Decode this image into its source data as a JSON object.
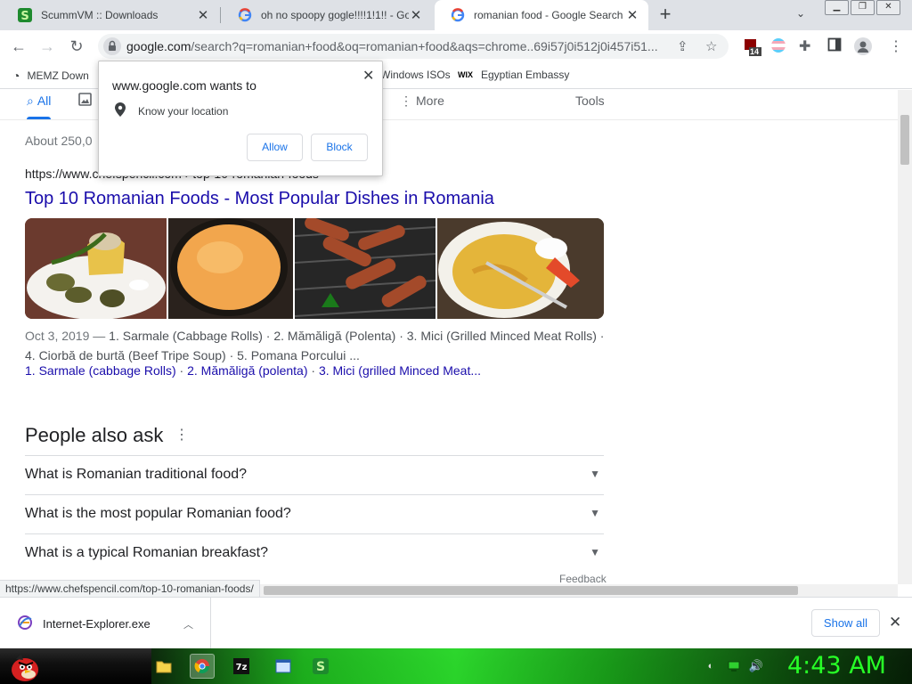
{
  "colors": {
    "link": "#1a0dab",
    "accent": "#1a73e8",
    "clock": "#27ff27"
  },
  "tabs": [
    {
      "title": "ScummVM :: Downloads",
      "icon": "scummvm-icon",
      "active": false
    },
    {
      "title": "oh no spoopy gogle!!!!1!1!! - Goo",
      "icon": "google-icon",
      "active": false
    },
    {
      "title": "romanian food - Google Search",
      "icon": "google-icon",
      "active": true
    }
  ],
  "omnibox": {
    "domain": "google.com",
    "path": "/search?q=romanian+food&oq=romanian+food&aqs=chrome..69i57j0i512j0i457i51..."
  },
  "extensions": {
    "badge": "14"
  },
  "bookmarks": [
    {
      "label": "MEMZ Down",
      "icon": "memz-icon"
    },
    {
      "label": "Windows ISOs",
      "icon": "windows-icon"
    },
    {
      "label": "Egyptian Embassy",
      "icon": "wix-icon"
    }
  ],
  "search_nav": {
    "all": "All",
    "more": "More",
    "tools": "Tools"
  },
  "result": {
    "stats": "About 250,0",
    "cite": "https://www.chefspencil.com › top-10-romanian-foods",
    "title": "Top 10 Romanian Foods - Most Popular Dishes in Romania",
    "date": "Oct 3, 2019 — ",
    "snippet": "1. Sarmale (Cabbage Rolls) · 2. Mămăligă (Polenta) · 3. Mici (Grilled Minced Meat Rolls) · 4. Ciorbă de burtă (Beef Tripe Soup) · 5. Pomana Porcului ...",
    "sublinks": [
      "1. Sarmale (cabbage Rolls)",
      "2. Mămăligă (polenta)",
      "3. Mici (grilled Minced Meat..."
    ]
  },
  "paa": {
    "title": "People also ask",
    "questions": [
      "What is Romanian traditional food?",
      "What is the most popular Romanian food?",
      "What is a typical Romanian breakfast?"
    ],
    "feedback": "Feedback"
  },
  "status_url": "https://www.chefspencil.com/top-10-romanian-foods/",
  "permission_popup": {
    "title": "www.google.com wants to",
    "request": "Know your location",
    "allow": "Allow",
    "block": "Block"
  },
  "download_shelf": {
    "file": "Internet-Explorer.exe",
    "show_all": "Show all"
  },
  "taskbar": {
    "clock": "4:43 AM"
  }
}
